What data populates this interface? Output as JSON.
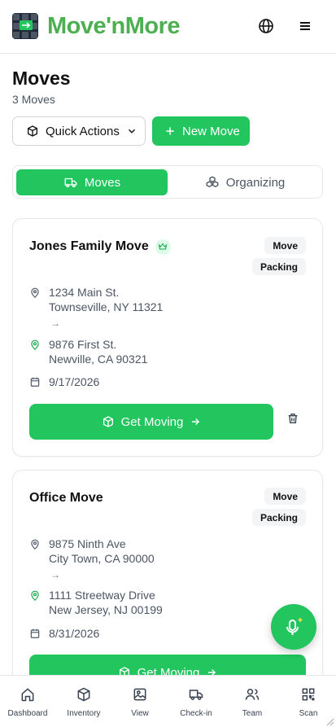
{
  "app": {
    "brand": "Move'nMore"
  },
  "page": {
    "title": "Moves",
    "subtitle": "3 Moves"
  },
  "actions": {
    "quick_actions": "Quick Actions",
    "new_move": "New Move"
  },
  "tabs": [
    {
      "label": "Moves",
      "active": true
    },
    {
      "label": "Organizing",
      "active": false
    }
  ],
  "moves": [
    {
      "name": "Jones Family Move",
      "premium": true,
      "badges": [
        "Move",
        "Packing"
      ],
      "from": {
        "line1": "1234 Main St.",
        "line2": "Townseville, NY 11321"
      },
      "arrow": "→",
      "to": {
        "line1": "9876 First St.",
        "line2": "Newville, CA 90321"
      },
      "date": "9/17/2026",
      "cta": "Get Moving"
    },
    {
      "name": "Office Move",
      "premium": false,
      "badges": [
        "Move",
        "Packing"
      ],
      "from": {
        "line1": "9875 Ninth Ave",
        "line2": "City Town, CA 90000"
      },
      "arrow": "→",
      "to": {
        "line1": "1111 Streetway Drive",
        "line2": "New Jersey, NJ 00199"
      },
      "date": "8/31/2026",
      "cta": "Get Moving"
    }
  ],
  "nav": [
    {
      "label": "Dashboard",
      "icon": "home-icon"
    },
    {
      "label": "Inventory",
      "icon": "box-icon"
    },
    {
      "label": "View",
      "icon": "image-icon"
    },
    {
      "label": "Check-in",
      "icon": "truck-icon"
    },
    {
      "label": "Team",
      "icon": "users-icon"
    },
    {
      "label": "Scan",
      "icon": "qr-icon"
    }
  ],
  "colors": {
    "accent": "#22c55e",
    "brand_text": "#4caf50",
    "logo_bg": "#1f2937",
    "border": "#e5e7eb"
  }
}
